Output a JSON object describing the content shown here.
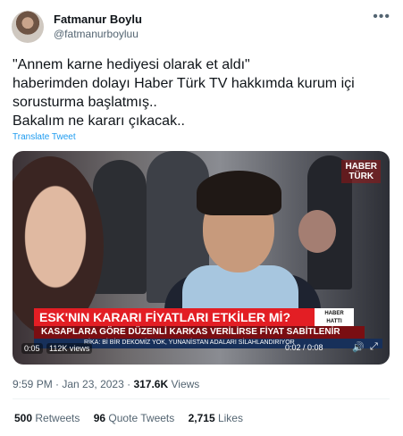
{
  "author": {
    "name": "Fatmanur Boylu",
    "handle": "@fatmanurboyluu"
  },
  "more_icon": "ellipsis-icon",
  "tweet": {
    "lines": [
      "\"Annem karne hediyesi olarak et aldı\"",
      "haberimden dolayı Haber Türk TV hakkımda kurum içi",
      "sorusturma başlatmış..",
      "Bakalım ne kararı çıkacak.."
    ],
    "translate": "Translate Tweet"
  },
  "video": {
    "logo_line1": "HABER",
    "logo_line2": "TÜRK",
    "headline": "ESK'NIN KARARI FİYATLARI ETKİLER Mİ?",
    "badge_line1": "HABER",
    "badge_line2": "HATTI",
    "subtitle": "KASAPLARA GÖRE DÜZENLİ KARKAS VERİLİRSE FİYAT SABİTLENİR",
    "ticker": "RİKA: Bİ BİR DEKOMİZ YOK, YUNANİSTAN ADALARI SİLAHLANDIRIYOR",
    "elapsed": "0:05",
    "views": "112K views",
    "progress": "0:02 / 0:08"
  },
  "meta": {
    "time": "9:59 PM",
    "separator": " · ",
    "date": "Jan 23, 2023",
    "view_count": "317.6K",
    "view_label": " Views"
  },
  "stats": {
    "retweets_count": "500",
    "retweets_label": " Retweets",
    "quotes_count": "96",
    "quotes_label": " Quote Tweets",
    "likes_count": "2,715",
    "likes_label": " Likes"
  }
}
